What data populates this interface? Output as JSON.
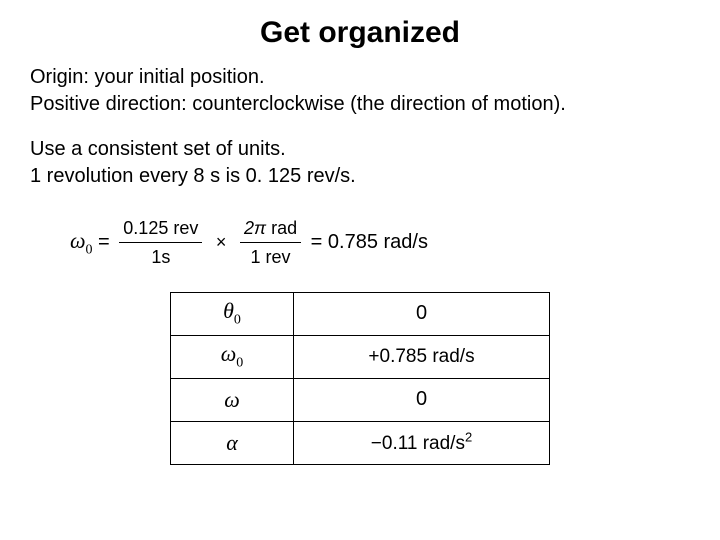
{
  "title": "Get organized",
  "para1_line1": "Origin: your initial position.",
  "para1_line2": "Positive direction: counterclockwise (the direction of motion).",
  "para2_line1": "Use a consistent set of units.",
  "para2_line2": "1 revolution every 8 s is 0. 125 rev/s.",
  "equation": {
    "lhs_symbol": "ω",
    "lhs_sub": "0",
    "frac1_num": "0.125 rev",
    "frac1_den": "1s",
    "times": "×",
    "frac2_num_pi": "2π",
    "frac2_num_unit": " rad",
    "frac2_den": "1 rev",
    "rhs": "= 0.785 rad/s"
  },
  "table": {
    "r1_sym": "θ",
    "r1_sub": "0",
    "r1_val": "0",
    "r2_sym": "ω",
    "r2_sub": "0",
    "r2_val": "+0.785 rad/s",
    "r3_sym": "ω",
    "r3_val": "0",
    "r4_sym": "α",
    "r4_val_num": "−0.11 rad/s",
    "r4_val_sup": "2"
  }
}
